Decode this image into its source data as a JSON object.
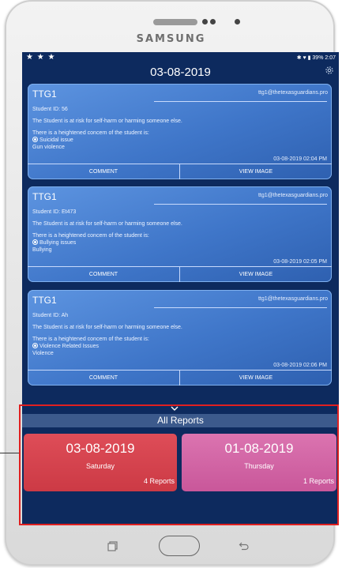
{
  "device": {
    "brand": "SAMSUNG"
  },
  "status_bar": {
    "indicators": "✱ ♥ ▮ 39% 2:07",
    "icons": [
      "star-icon",
      "star-icon",
      "star-icon"
    ]
  },
  "app_bar": {
    "title": "03-08-2019",
    "settings_icon": "gear-icon"
  },
  "cards": [
    {
      "tag": "TTG1",
      "email": "ttg1@thetexasguardians.pro",
      "student": "Student ID: 56",
      "risk": "The Student is at risk for self-harm or harming someone else.",
      "concern_intro": "There is a heightened concern of the student is:",
      "concern_selected": "Suicidal issue",
      "concern_other": "Gun violence",
      "timestamp": "03-08-2019 02:04 PM",
      "comment_label": "COMMENT",
      "view_label": "VIEW IMAGE"
    },
    {
      "tag": "TTG1",
      "email": "ttg1@thetexasguardians.pro",
      "student": "Student ID: Et473",
      "risk": "The Student is at risk for self-harm or harming someone else.",
      "concern_intro": "There is a heightened concern of the student is:",
      "concern_selected": "Bullying issues",
      "concern_other": "Bullying",
      "timestamp": "03-08-2019 02:05 PM",
      "comment_label": "COMMENT",
      "view_label": "VIEW IMAGE"
    },
    {
      "tag": "TTG1",
      "email": "ttg1@thetexasguardians.pro",
      "student": "Student ID: Ah",
      "risk": "The Student is at risk for self-harm or harming someone else.",
      "concern_intro": "There is a heightened concern of the student is:",
      "concern_selected": "Violence Related Issues",
      "concern_other": "Violence",
      "timestamp": "03-08-2019 02:06 PM",
      "comment_label": "COMMENT",
      "view_label": "VIEW IMAGE"
    }
  ],
  "reports_drawer": {
    "title": "All Reports",
    "days": [
      {
        "date": "03-08-2019",
        "weekday": "Saturday",
        "count": "4 Reports",
        "color": "#d8434f"
      },
      {
        "date": "01-08-2019",
        "weekday": "Thursday",
        "count": "1 Reports",
        "color": "#d46aa8"
      }
    ]
  },
  "colors": {
    "screen_bg": "#0d2a5e",
    "card_blue": "#4a82d6",
    "highlight": "#e02020"
  }
}
